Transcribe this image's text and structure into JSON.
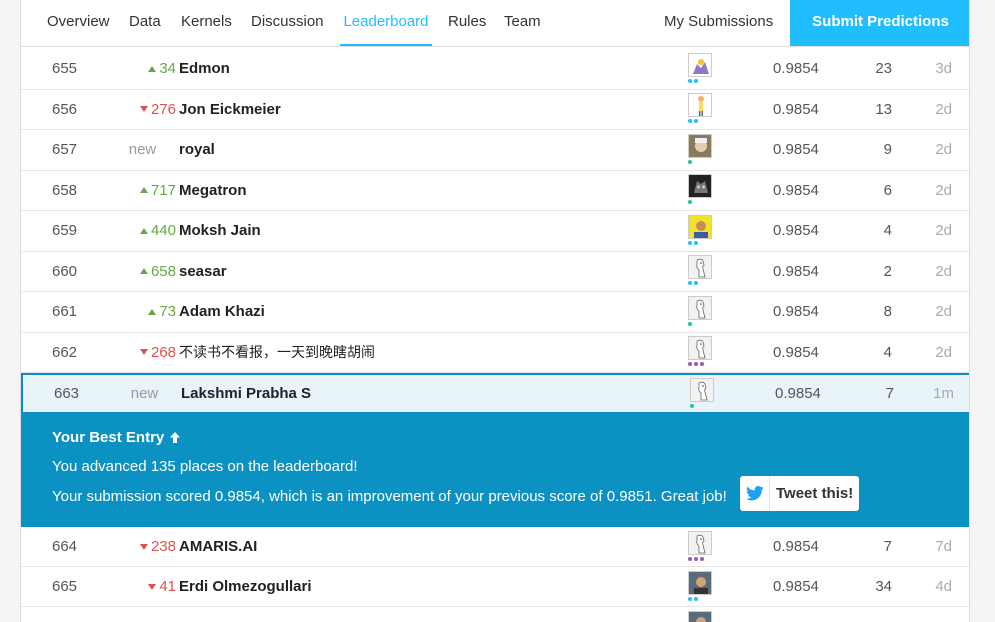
{
  "nav": {
    "tabs": [
      {
        "label": "Overview"
      },
      {
        "label": "Data"
      },
      {
        "label": "Kernels"
      },
      {
        "label": "Discussion"
      },
      {
        "label": "Leaderboard"
      },
      {
        "label": "Rules"
      },
      {
        "label": "Team"
      }
    ],
    "active_tab": "Leaderboard",
    "my_submissions": "My Submissions",
    "submit_predictions": "Submit Predictions"
  },
  "colors": {
    "accent": "#20beff",
    "banner": "#0b91c2",
    "up": "#66a844",
    "down": "#d9534f"
  },
  "rows": [
    {
      "rank": "655",
      "dir": "up",
      "delta": "34",
      "name": "Edmon",
      "score": "0.9854",
      "entries": "23",
      "last": "3d",
      "avatar": "cartoon",
      "dots": [
        "#20beff",
        "#20beff"
      ]
    },
    {
      "rank": "656",
      "dir": "down",
      "delta": "276",
      "name": "Jon Eickmeier",
      "score": "0.9854",
      "entries": "13",
      "last": "2d",
      "avatar": "figure",
      "dots": [
        "#20beff",
        "#20beff"
      ]
    },
    {
      "rank": "657",
      "dir": "new",
      "delta": "new",
      "name": "royal",
      "score": "0.9854",
      "entries": "9",
      "last": "2d",
      "avatar": "photo-face",
      "dots": [
        "#20c997"
      ]
    },
    {
      "rank": "658",
      "dir": "up",
      "delta": "717",
      "name": "Megatron",
      "score": "0.9854",
      "entries": "6",
      "last": "2d",
      "avatar": "robot",
      "dots": [
        "#20c997"
      ]
    },
    {
      "rank": "659",
      "dir": "up",
      "delta": "440",
      "name": "Moksh Jain",
      "score": "0.9854",
      "entries": "4",
      "last": "2d",
      "avatar": "yellow-photo",
      "dots": [
        "#20beff",
        "#20beff"
      ]
    },
    {
      "rank": "660",
      "dir": "up",
      "delta": "658",
      "name": "seasar",
      "score": "0.9854",
      "entries": "2",
      "last": "2d",
      "avatar": "default",
      "dots": [
        "#20beff",
        "#20beff"
      ]
    },
    {
      "rank": "661",
      "dir": "up",
      "delta": "73",
      "name": "Adam Khazi",
      "score": "0.9854",
      "entries": "8",
      "last": "2d",
      "avatar": "default",
      "dots": [
        "#20c997"
      ]
    },
    {
      "rank": "662",
      "dir": "down",
      "delta": "268",
      "name": "不读书不看报，一天到晚瞎胡闹",
      "score": "0.9854",
      "entries": "4",
      "last": "2d",
      "avatar": "default",
      "dots": [
        "#9b59b6",
        "#9b59b6",
        "#9b59b6"
      ]
    },
    {
      "rank": "663",
      "dir": "new",
      "delta": "new",
      "name": "Lakshmi Prabha S",
      "score": "0.9854",
      "entries": "7",
      "last": "1m",
      "avatar": "default",
      "dots": [
        "#20c997"
      ],
      "highlight": true
    }
  ],
  "banner": {
    "title": "Your Best Entry",
    "line1": "You advanced 135 places on the leaderboard!",
    "line2": "Your submission scored 0.9854, which is an improvement of your previous score of 0.9851. Great job!",
    "tweet_label": "Tweet this!"
  },
  "rows_after": [
    {
      "rank": "664",
      "dir": "down",
      "delta": "238",
      "name": "AMARIS.AI",
      "score": "0.9854",
      "entries": "7",
      "last": "7d",
      "avatar": "default",
      "dots": [
        "#9b59b6",
        "#9b59b6",
        "#9b59b6"
      ]
    },
    {
      "rank": "665",
      "dir": "down",
      "delta": "41",
      "name": "Erdi Olmezogullari",
      "score": "0.9854",
      "entries": "34",
      "last": "4d",
      "avatar": "photo-man",
      "dots": [
        "#20beff",
        "#20beff"
      ]
    }
  ]
}
